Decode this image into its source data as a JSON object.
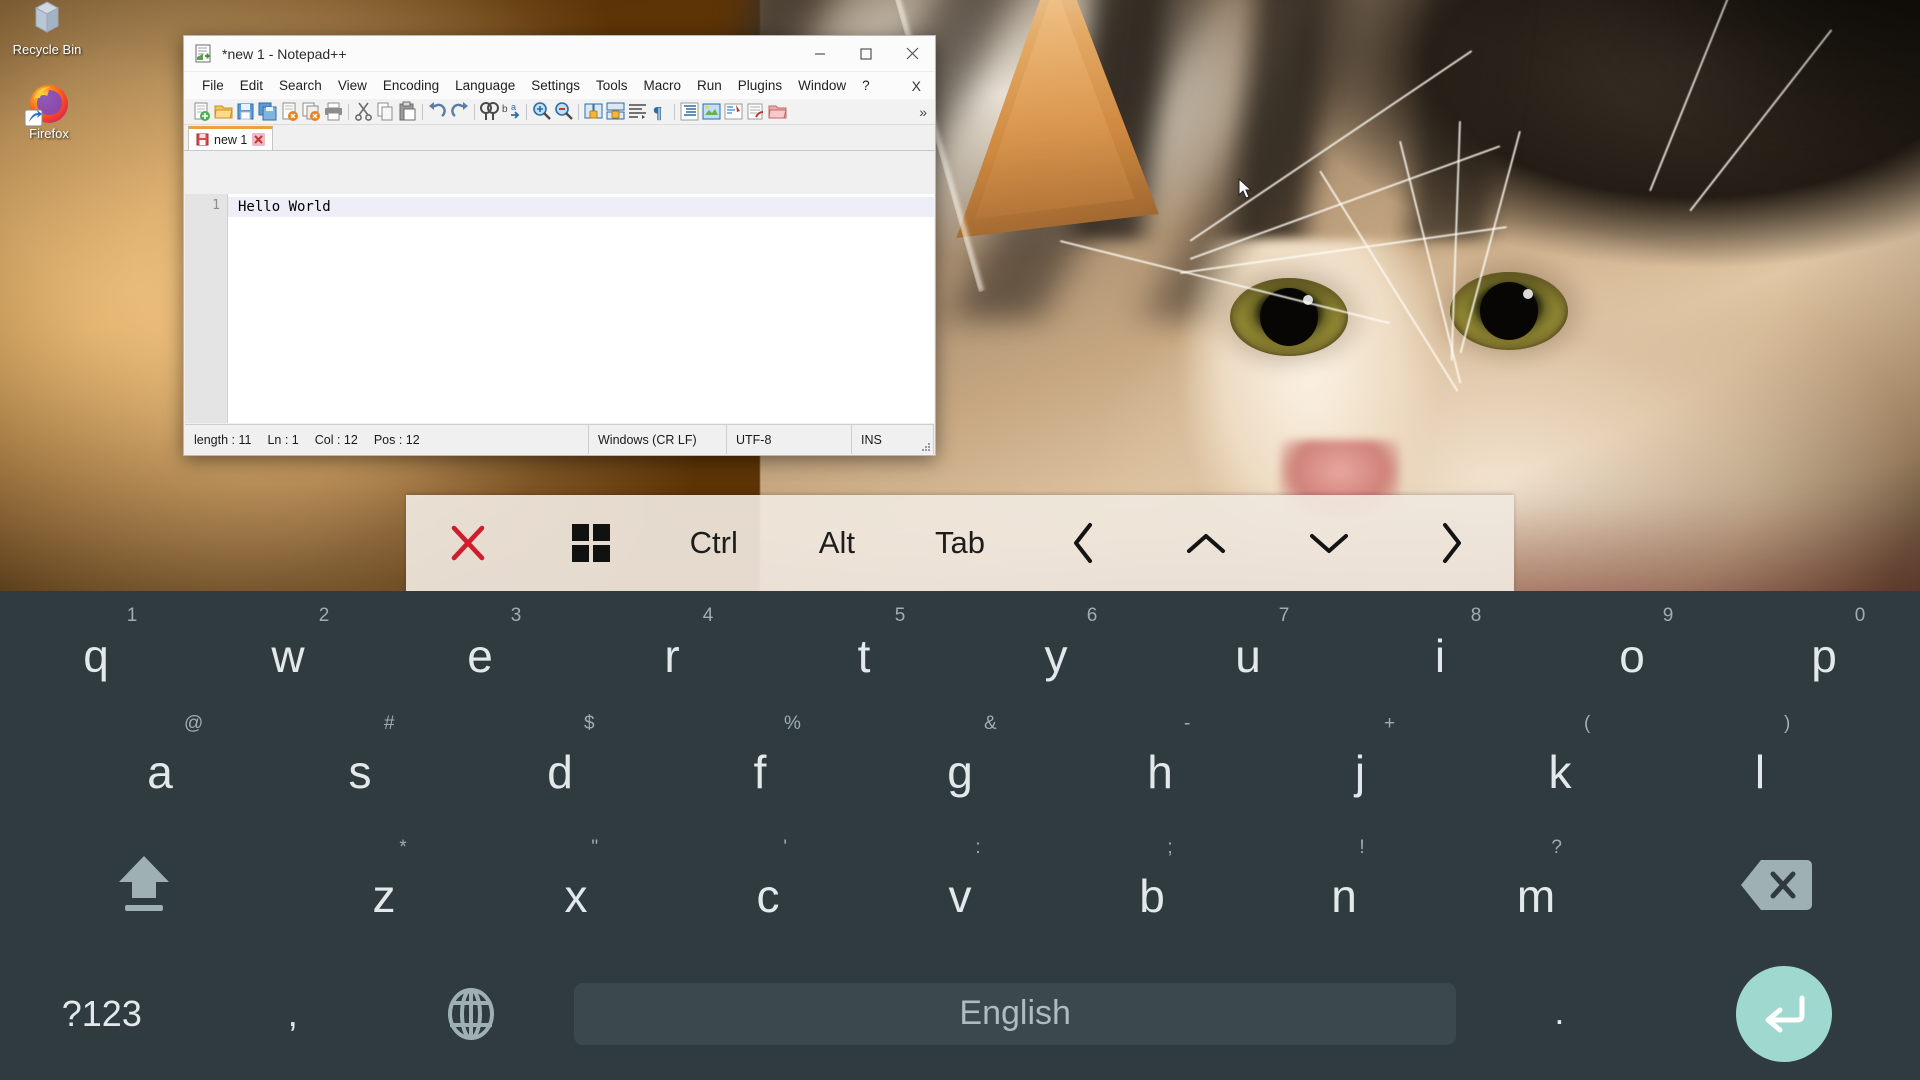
{
  "desktop": {
    "icons": [
      {
        "name": "recycle-bin",
        "label": "Recycle Bin",
        "icon": "recycle-bin-icon"
      },
      {
        "name": "firefox",
        "label": "Firefox",
        "icon": "firefox-icon"
      }
    ],
    "wallpaper_description": "close-up photo of a calico tabby cat",
    "wallpaper_accent": "#a8650f"
  },
  "notepad": {
    "title": "*new 1 - Notepad++",
    "window_icon": "notepad-plus-plus-icon",
    "window_buttons": {
      "minimize": "minimize-icon",
      "maximize": "maximize-icon",
      "close": "close-icon"
    },
    "menus": [
      "File",
      "Edit",
      "Search",
      "View",
      "Encoding",
      "Language",
      "Settings",
      "Tools",
      "Macro",
      "Run",
      "Plugins",
      "Window",
      "?"
    ],
    "menu_close_label": "X",
    "toolbar_overflow": "»",
    "toolbar_buttons": [
      "new-file-icon",
      "open-file-icon",
      "save-icon",
      "save-all-icon",
      "close-file-icon",
      "close-all-icon",
      "print-icon",
      "cut-icon",
      "copy-icon",
      "paste-icon",
      "undo-icon",
      "redo-icon",
      "find-icon",
      "replace-icon",
      "zoom-in-icon",
      "zoom-out-icon",
      "sync-vertical-icon",
      "sync-horizontal-icon",
      "word-wrap-icon",
      "show-all-chars-icon",
      "indent-guide-icon",
      "ui-user-define-icon",
      "document-map-icon",
      "function-list-icon",
      "folder-as-workspace-icon"
    ],
    "tab": {
      "label": "new 1",
      "save_state_icon": "unsaved-disk-icon",
      "close_icon": "tab-close-icon"
    },
    "editor": {
      "line_numbers": [
        "1"
      ],
      "lines": [
        "Hello World"
      ]
    },
    "status": {
      "length_label": "length : 11",
      "ln_label": "Ln : 1",
      "col_label": "Col : 12",
      "pos_label": "Pos : 12",
      "eol": "Windows (CR LF)",
      "encoding": "UTF-8",
      "insert_mode": "INS"
    }
  },
  "function_bar": {
    "keys": [
      {
        "name": "close-keyboard",
        "label": "✕",
        "icon": "close-icon"
      },
      {
        "name": "windows-key",
        "label": "",
        "icon": "windows-logo-icon"
      },
      {
        "name": "ctrl-key",
        "label": "Ctrl",
        "icon": ""
      },
      {
        "name": "alt-key",
        "label": "Alt",
        "icon": ""
      },
      {
        "name": "tab-key",
        "label": "Tab",
        "icon": ""
      },
      {
        "name": "arrow-left-key",
        "label": "❮",
        "icon": "chevron-left-icon"
      },
      {
        "name": "arrow-up-key",
        "label": "∧",
        "icon": "chevron-up-icon"
      },
      {
        "name": "arrow-down-key",
        "label": "∨",
        "icon": "chevron-down-icon"
      },
      {
        "name": "arrow-right-key",
        "label": "❯",
        "icon": "chevron-right-icon"
      }
    ],
    "background_color": "#f0e8de",
    "close_color": "#d01d2e"
  },
  "keyboard": {
    "background_color": "#2f3b3f",
    "accent_color": "#9fd8ce",
    "row1": [
      {
        "main": "q",
        "sup": "1"
      },
      {
        "main": "w",
        "sup": "2"
      },
      {
        "main": "e",
        "sup": "3"
      },
      {
        "main": "r",
        "sup": "4"
      },
      {
        "main": "t",
        "sup": "5"
      },
      {
        "main": "y",
        "sup": "6"
      },
      {
        "main": "u",
        "sup": "7"
      },
      {
        "main": "i",
        "sup": "8"
      },
      {
        "main": "o",
        "sup": "9"
      },
      {
        "main": "p",
        "sup": "0"
      }
    ],
    "row2": [
      {
        "main": "a",
        "sup": "@"
      },
      {
        "main": "s",
        "sup": "#"
      },
      {
        "main": "d",
        "sup": "$"
      },
      {
        "main": "f",
        "sup": "%"
      },
      {
        "main": "g",
        "sup": "&"
      },
      {
        "main": "h",
        "sup": "-"
      },
      {
        "main": "j",
        "sup": "+"
      },
      {
        "main": "k",
        "sup": "("
      },
      {
        "main": "l",
        "sup": ")"
      }
    ],
    "row3": {
      "shift": {
        "name": "shift-key",
        "icon": "shift-arrow-icon"
      },
      "letters": [
        {
          "main": "z",
          "sup": "*"
        },
        {
          "main": "x",
          "sup": "\""
        },
        {
          "main": "c",
          "sup": "'"
        },
        {
          "main": "v",
          "sup": ":"
        },
        {
          "main": "b",
          "sup": ";"
        },
        {
          "main": "n",
          "sup": "!"
        },
        {
          "main": "m",
          "sup": "?"
        }
      ],
      "backspace": {
        "name": "backspace-key",
        "icon": "backspace-icon"
      }
    },
    "row4": {
      "symbols": "?123",
      "comma": ",",
      "globe_icon": "globe-icon",
      "space_label": "English",
      "period": ".",
      "enter_icon": "enter-arrow-icon"
    }
  },
  "pointer": {
    "icon": "mouse-cursor-icon"
  }
}
